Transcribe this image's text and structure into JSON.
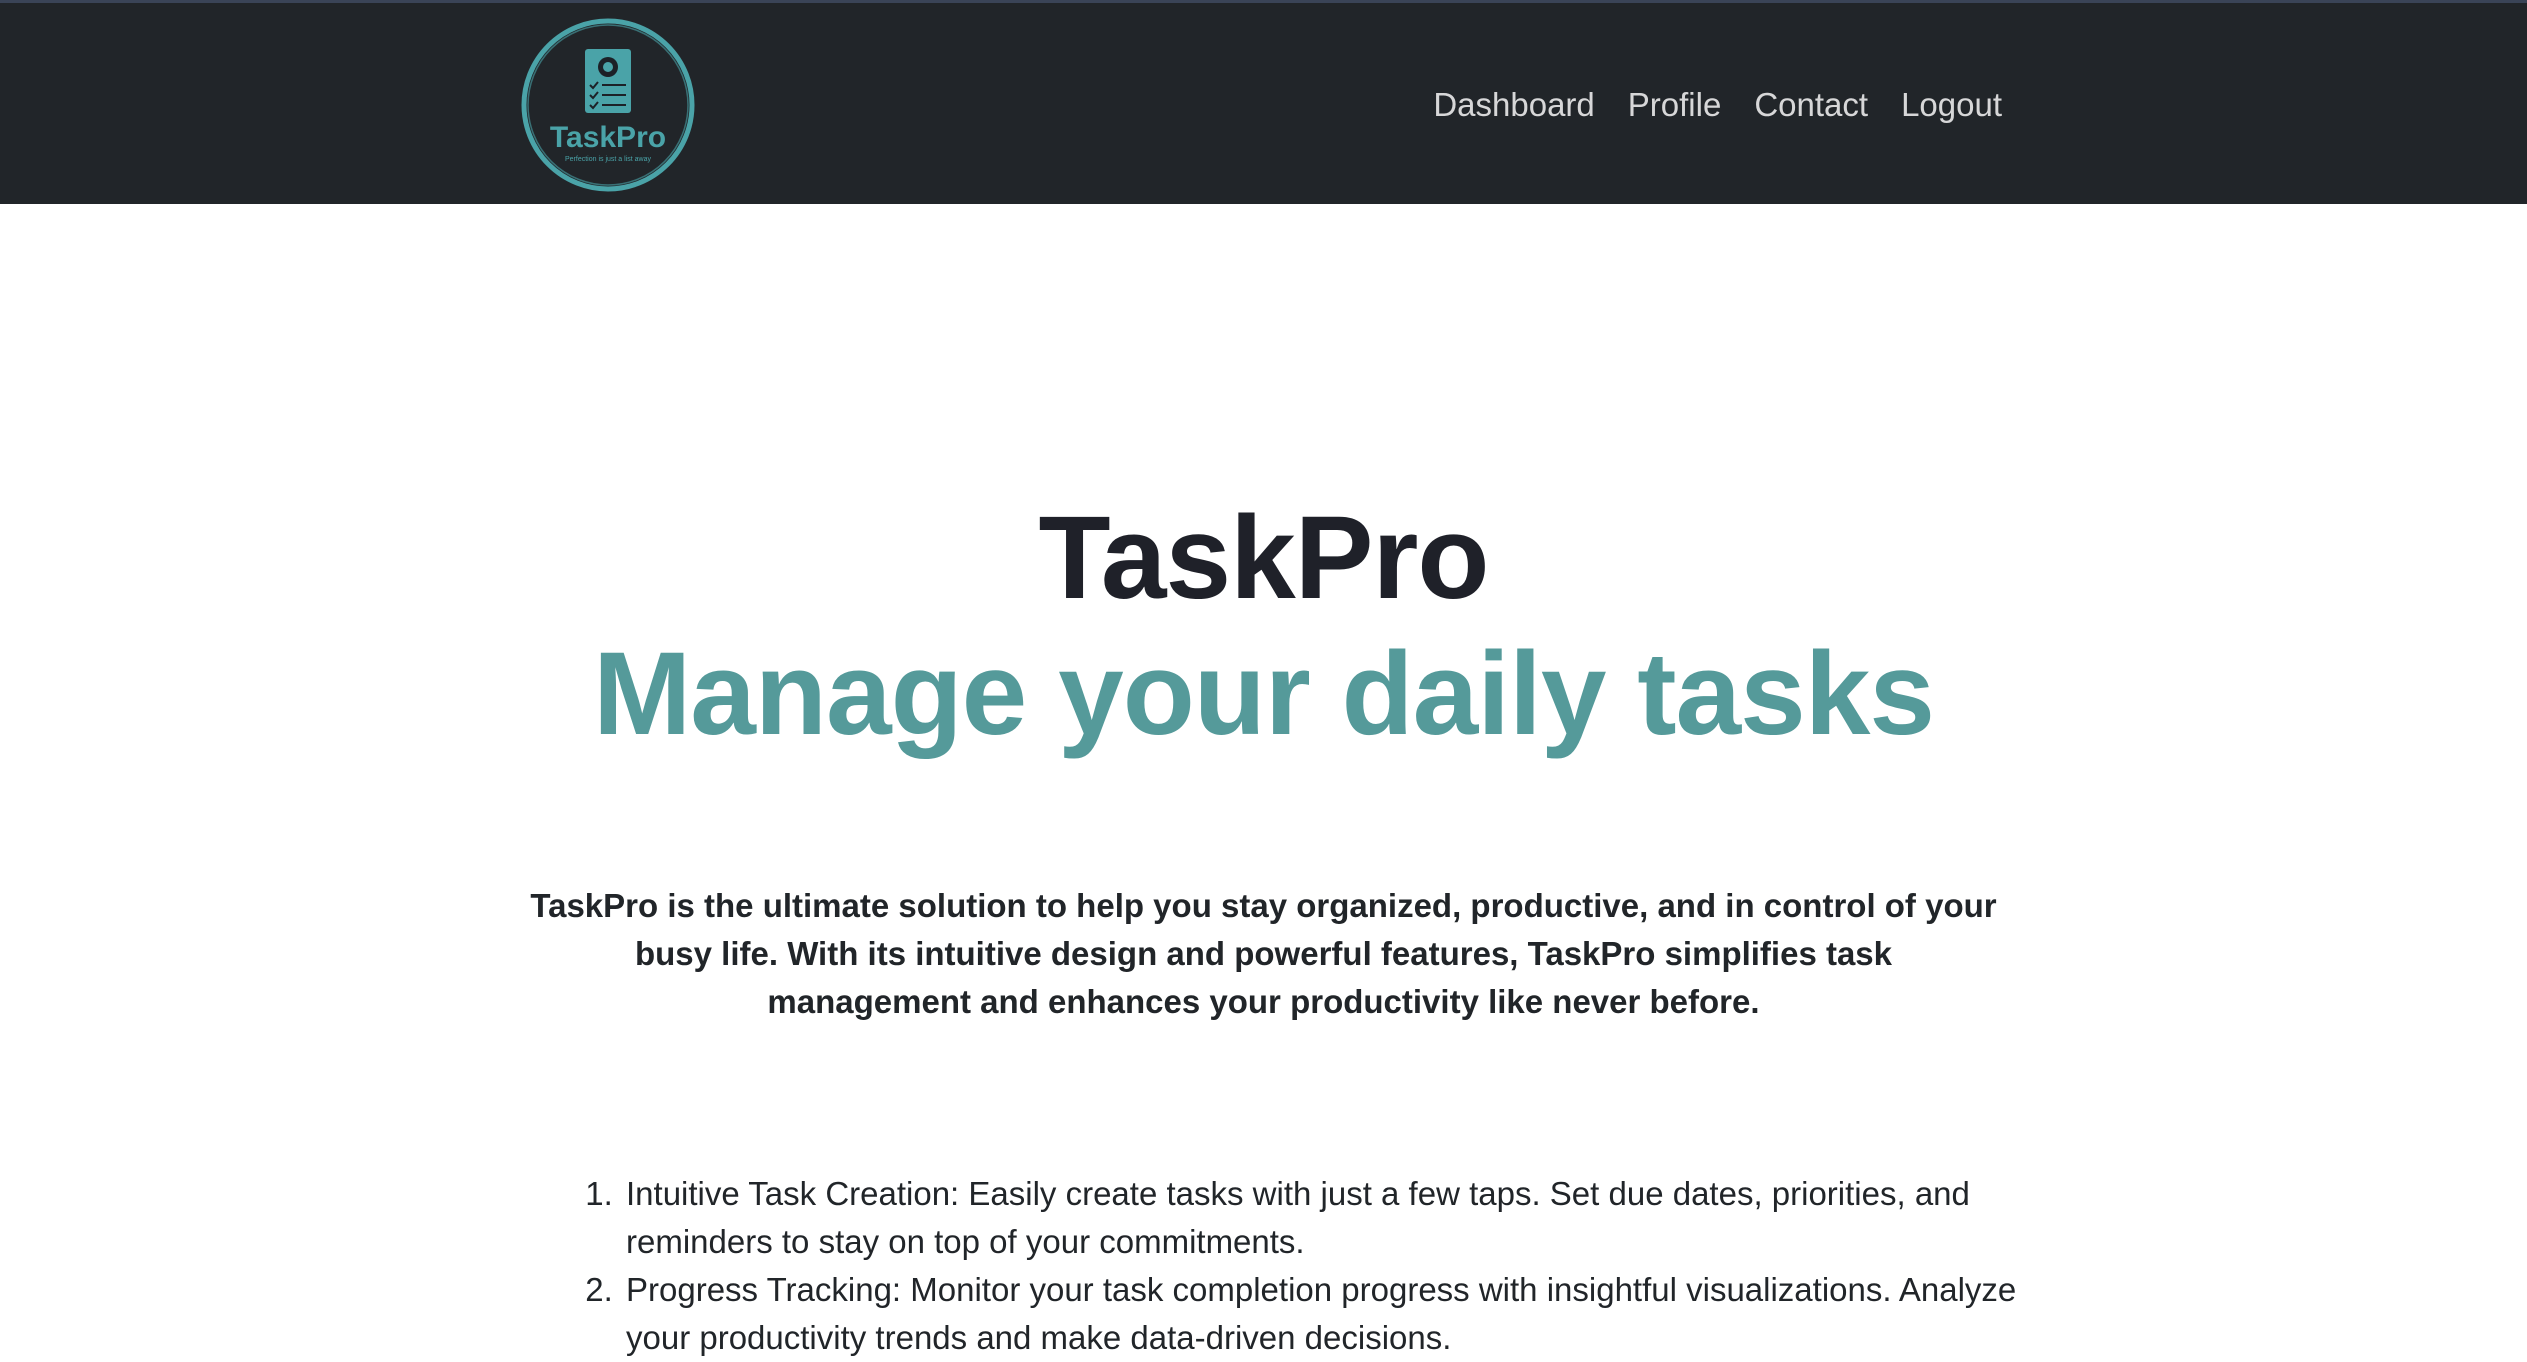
{
  "brand": {
    "logo_text": "TaskPro",
    "logo_tagline": "Perfection is just a list away",
    "accent_color": "#559a9a",
    "nav_bg": "#212529"
  },
  "nav": {
    "links": [
      "Dashboard",
      "Profile",
      "Contact",
      "Logout"
    ]
  },
  "hero": {
    "title": "TaskPro",
    "subtitle": "Manage your daily tasks"
  },
  "intro": "TaskPro is the ultimate solution to help you stay organized, productive, and in control of your busy life. With its intuitive design and powerful features, TaskPro simplifies task management and enhances your productivity like never before.",
  "features": [
    "Intuitive Task Creation: Easily create tasks with just a few taps. Set due dates, priorities, and reminders to stay on top of your commitments.",
    "Progress Tracking: Monitor your task completion progress with insightful visualizations. Analyze your productivity trends and make data-driven decisions."
  ]
}
